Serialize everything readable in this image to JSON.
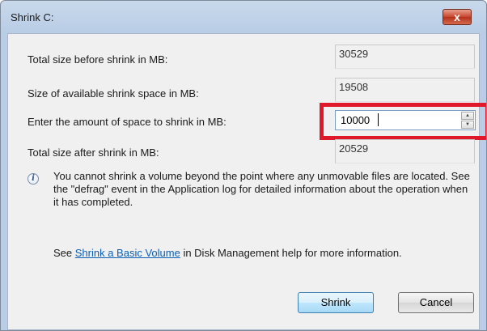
{
  "window": {
    "title": "Shrink C:",
    "close_label": "x"
  },
  "fields": {
    "total_before": {
      "label": "Total size before shrink in MB:",
      "value": "30529"
    },
    "available_shrink": {
      "label": "Size of available shrink space in MB:",
      "value": "19508"
    },
    "shrink_amount": {
      "label": "Enter the amount of space to shrink in MB:",
      "value": "10000"
    },
    "total_after": {
      "label": "Total size after shrink in MB:",
      "value": "20529"
    }
  },
  "info": {
    "icon": "info-icon",
    "text": "You cannot shrink a volume beyond the point where any unmovable files are located. See the \"defrag\" event in the Application log for detailed information about the operation when it has completed."
  },
  "help": {
    "prefix": "See ",
    "link_text": "Shrink a Basic Volume",
    "suffix": " in Disk Management help for more information."
  },
  "buttons": {
    "shrink": "Shrink",
    "cancel": "Cancel"
  },
  "colors": {
    "highlight": "#e0192a",
    "link": "#0b5fb4",
    "close": "#c7452d"
  }
}
